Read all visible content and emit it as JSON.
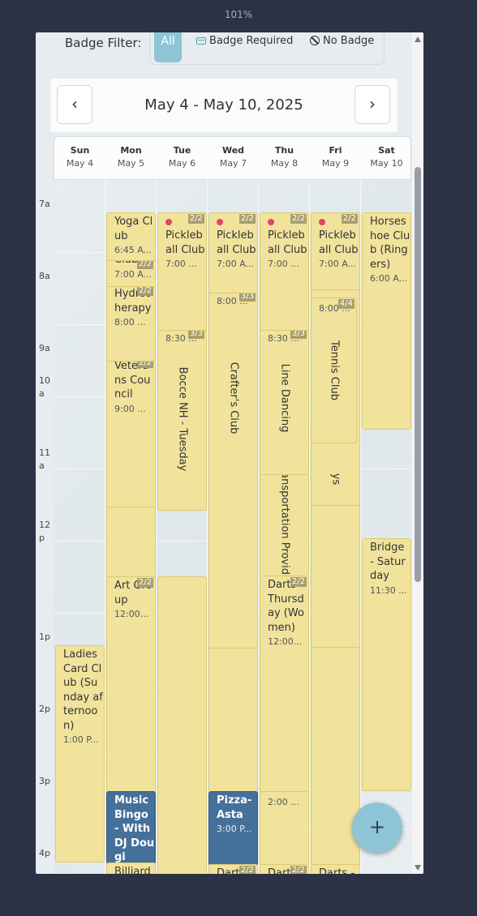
{
  "zoom_label": "101%",
  "filter": {
    "label": "Badge Filter:",
    "all": "All",
    "badge_required": "Badge Required",
    "no_badge": "No Badge"
  },
  "nav": {
    "prev": "‹",
    "next": "›",
    "title": "May 4 - May 10, 2025"
  },
  "days": [
    {
      "day": "Sun",
      "date": "May 4"
    },
    {
      "day": "Mon",
      "date": "May 5"
    },
    {
      "day": "Tue",
      "date": "May 6"
    },
    {
      "day": "Wed",
      "date": "May 7"
    },
    {
      "day": "Thu",
      "date": "May 8"
    },
    {
      "day": "Fri",
      "date": "May 9"
    },
    {
      "day": "Sat",
      "date": "May 10"
    }
  ],
  "hours": [
    "7a",
    "8a",
    "9a",
    "10\na",
    "11\na",
    "12\np",
    "1p",
    "2p",
    "3p",
    "4p"
  ],
  "events": {
    "yoga": {
      "title": "Yoga Club",
      "time": "6:45 A..."
    },
    "mon_club": {
      "title": "Club",
      "time": "7:00 A...",
      "badge": "2/2"
    },
    "hydro": {
      "title": "Hydrotherapy",
      "time": "8:00 ...",
      "badge": "2/2"
    },
    "veterans": {
      "title": "Veterans Council",
      "time": "9:00 ...",
      "badge": "2/2"
    },
    "art": {
      "title": "Art Group",
      "time": "12:00...",
      "badge": "2/2"
    },
    "music_bingo": {
      "title": "Music Bingo - With DJ Dougi"
    },
    "billiards": {
      "title": "Billiards - Ringer"
    },
    "tue_pickle": {
      "title": "Pickleball Club",
      "time": "7:00 ...",
      "badge": "2/2"
    },
    "bocce": {
      "title": "Bocce NH - Tuesday",
      "time": "8:30 ...",
      "badge": "3/3"
    },
    "wed_pickle": {
      "title": "Pickleball Club",
      "time": "7:00 A...",
      "badge": "2/2"
    },
    "crafters": {
      "title": "Crafter's Club",
      "time": "8:00 ...",
      "badge": "3/3"
    },
    "pizza": {
      "title": "Pizza-Asta",
      "time": "3:00 P..."
    },
    "wed_darts": {
      "title": "Darts - Wedn",
      "badge": "2/2"
    },
    "thu_pickle": {
      "title": "Pickleball Club",
      "time": "7:00 ...",
      "badge": "2/2"
    },
    "line_dancing": {
      "title": "Line Dancing",
      "time": "8:30 ...",
      "badge": "3/3"
    },
    "transport": {
      "title": "Transportation Provided"
    },
    "thu_darts_women": {
      "title": "Darts - Thursday (Women)",
      "time": "12:00...",
      "badge": "2/2"
    },
    "thu_2pm": {
      "time": "2:00 ..."
    },
    "thu_darts": {
      "title": "Darts - Thurs",
      "badge": "2/2"
    },
    "fri_pickle": {
      "title": "Pickleball Club",
      "time": "7:00 A...",
      "badge": "2/2"
    },
    "tennis": {
      "title": "Tennis Club",
      "time": "8:00 ...",
      "badge": "4/4"
    },
    "fri_ys": {
      "title": "ys"
    },
    "fri_darts": {
      "title": "Darts - Thurs"
    },
    "horseshoe": {
      "title": "Horseshoe Club (Ringers)",
      "time": "6:00 A..."
    },
    "bridge": {
      "title": "Bridge - Saturday",
      "time": "11:30 ..."
    },
    "ladies": {
      "title": "Ladies Card Club (Sunday afternoon)",
      "time": "1:00 P..."
    }
  },
  "fab_label": "+",
  "colors": {
    "event_bg": "#f1e39c",
    "event_blue": "#44709a",
    "accent": "#8ec5d6"
  }
}
